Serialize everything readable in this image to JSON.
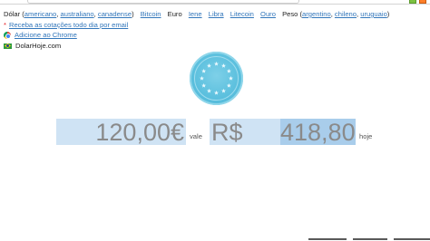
{
  "nav": {
    "dolar": "Dólar (",
    "americano": "americano",
    "australiano": "australiano",
    "canadense": "canadense",
    "dolar_close": ")",
    "bitcoin": "Bitcoin",
    "euro": "Euro",
    "iene": "Iene",
    "libra": "Libra",
    "litecoin": "Litecoin",
    "ouro": "Ouro",
    "peso": "Peso (",
    "argentino": "argentino",
    "chileno": "chileno",
    "uruguaio": "uruguaio",
    "peso_close": ")"
  },
  "subscribe": {
    "star": "*",
    "label": "Receba as cotações todo dia por email"
  },
  "chrome": {
    "label": "Adicione ao Chrome"
  },
  "site": {
    "label": "DolarHoje.com"
  },
  "converter": {
    "from_amount": "120,00€",
    "vale": "vale",
    "to_currency": "R$",
    "to_amount": "418,80",
    "hoje": "hoje"
  },
  "colors": {
    "link": "#3377bb",
    "coin": "#5cc0de",
    "field_bg": "#cfe3f4",
    "selection_bg": "#a9cdeb"
  },
  "icons": {
    "coin": "euro-coin-icon",
    "chrome": "chrome-icon",
    "flag": "brazil-flag-icon"
  }
}
